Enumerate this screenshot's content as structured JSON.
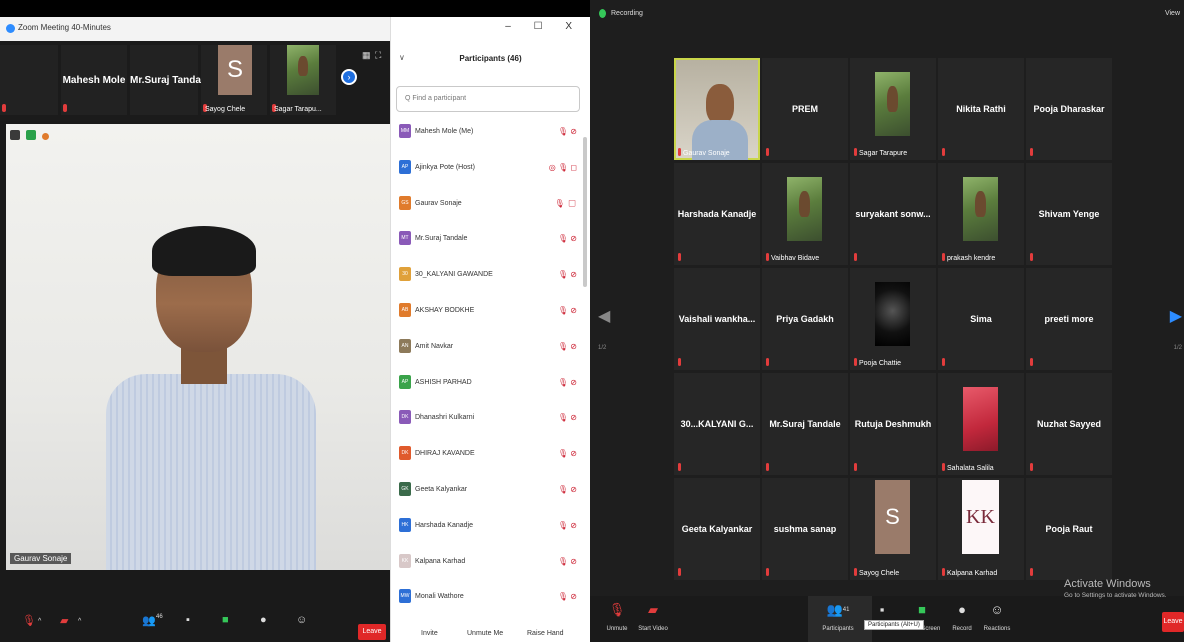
{
  "left": {
    "window_title": "Zoom Meeting 40-Minutes",
    "strip": {
      "tiles": [
        {
          "name": "Mahesh Mole"
        },
        {
          "name": "Mr.Suraj Tandale"
        }
      ],
      "sayog_letter": "S",
      "sayog_name": "Sayog Chele",
      "sagar_name": "Sagar Tarapu..."
    },
    "speaker_name": "Gaurav Sonaje",
    "toolbar": {
      "participants_count": "46",
      "leave_label": "Leave"
    },
    "panel": {
      "window_controls": "– ☐ X",
      "title": "Participants (46)",
      "search_placeholder": "Q Find a participant",
      "participants": [
        {
          "initials": "MM",
          "name": "Mahesh Mole (Me)",
          "status": "🎙 ⊘",
          "color": "#8a5ab8"
        },
        {
          "initials": "AP",
          "name": "Ajinkya Pote (Host)",
          "status": "◎ 🎙 ◻",
          "color": "#2d6fd6"
        },
        {
          "initials": "GS",
          "name": "Gaurav Sonaje",
          "status": "🎙 ◻",
          "color": "#e07b2c"
        },
        {
          "initials": "MT",
          "name": "Mr.Suraj Tandale",
          "status": "🎙 ⊘",
          "color": "#8a5ab8"
        },
        {
          "initials": "30",
          "name": "30_KALYANI GAWANDE",
          "status": "🎙 ⊘",
          "color": "#e0a13a"
        },
        {
          "initials": "AB",
          "name": "AKSHAY BODKHE",
          "status": "🎙 ⊘",
          "color": "#e07b2c"
        },
        {
          "initials": "AN",
          "name": "Amit Navkar",
          "status": "🎙 ⊘",
          "color": "#8d7a5a"
        },
        {
          "initials": "AP",
          "name": "ASHISH PARHAD",
          "status": "🎙 ⊘",
          "color": "#3aa34a"
        },
        {
          "initials": "DK",
          "name": "Dhanashri Kulkarni",
          "status": "🎙 ⊘",
          "color": "#8a5ab8"
        },
        {
          "initials": "DK",
          "name": "DHIRAJ KAVANDE",
          "status": "🎙 ⊘",
          "color": "#e05a2c"
        },
        {
          "initials": "GK",
          "name": "Geeta Kalyankar",
          "status": "🎙 ⊘",
          "color": "#3a6a4a"
        },
        {
          "initials": "HK",
          "name": "Harshada Kanadje",
          "status": "🎙 ⊘",
          "color": "#2d6fd6"
        },
        {
          "initials": "KK",
          "name": "Kalpana Karhad",
          "status": "🎙 ⊘",
          "color": "#d8c8c8"
        },
        {
          "initials": "MW",
          "name": "Monali Wathore",
          "status": "🎙 ⊘",
          "color": "#2d6fd6"
        }
      ],
      "footer": {
        "invite": "Invite",
        "unmute_me": "Unmute Me",
        "raise_hand": "Raise Hand"
      }
    }
  },
  "right": {
    "recording_label": "Recording",
    "view_label": "View",
    "grid": [
      {
        "type": "speaker",
        "sub": "Gaurav Sonaje"
      },
      {
        "type": "name",
        "name": "PREM"
      },
      {
        "type": "photo",
        "sub": "Sagar Tarapure"
      },
      {
        "type": "name",
        "name": "Nikita Rathi"
      },
      {
        "type": "name",
        "name": "Pooja Dharaskar"
      },
      {
        "type": "name",
        "name": "Harshada Kanadje"
      },
      {
        "type": "photo",
        "sub": "Vaibhav Bidave"
      },
      {
        "type": "name",
        "name": "suryakant sonw..."
      },
      {
        "type": "photo",
        "sub": "prakash kendre"
      },
      {
        "type": "name",
        "name": "Shivam Yenge"
      },
      {
        "type": "name",
        "name": "Vaishali wankha..."
      },
      {
        "type": "name",
        "name": "Priya Gadakh"
      },
      {
        "type": "dark",
        "sub": "Pooja Chattie"
      },
      {
        "type": "name",
        "name": "Sima"
      },
      {
        "type": "name",
        "name": "preeti more"
      },
      {
        "type": "name",
        "name": "30...KALYANI G..."
      },
      {
        "type": "name",
        "name": "Mr.Suraj Tandale"
      },
      {
        "type": "name",
        "name": "Rutuja Deshmukh"
      },
      {
        "type": "red",
        "sub": "Sahalata Salila"
      },
      {
        "type": "name",
        "name": "Nuzhat Sayyed"
      },
      {
        "type": "name",
        "name": "Geeta Kalyankar"
      },
      {
        "type": "name",
        "name": "sushma sanap"
      },
      {
        "type": "letter",
        "letter": "S",
        "sub": "Sayog Chele"
      },
      {
        "type": "kk",
        "letter": "KK",
        "sub": "Kalpana Karhad"
      },
      {
        "type": "name",
        "name": "Pooja Raut"
      }
    ],
    "page_left": "1/2",
    "page_right": "1/2",
    "toolbar": {
      "unmute": "Unmute",
      "start_video": "Start Video",
      "participants": "Participants",
      "participants_count": "41",
      "share_screen": "Share Screen",
      "record": "Record",
      "reactions": "Reactions",
      "leave": "Leave",
      "tooltip": "Participants (Alt+U)"
    },
    "activate": {
      "line1": "Activate Windows",
      "line2": "Go to Settings to activate Windows."
    }
  }
}
